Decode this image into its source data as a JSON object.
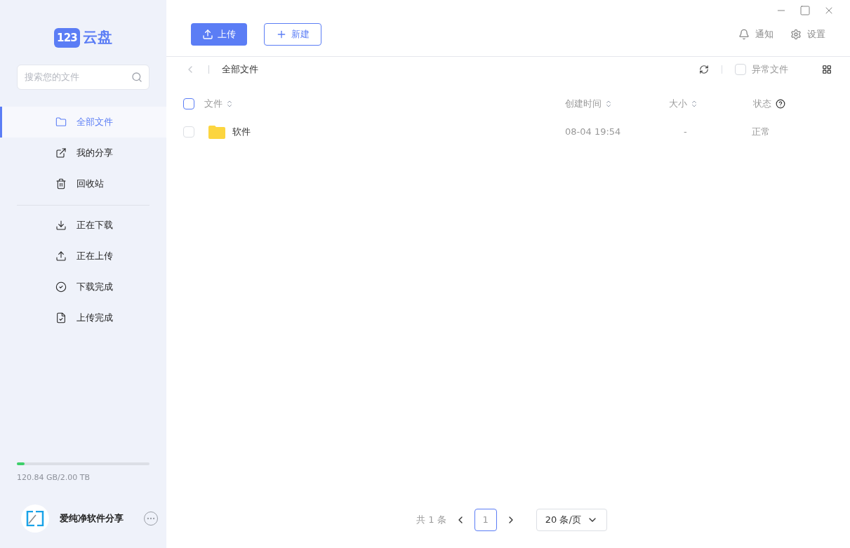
{
  "logo": {
    "badge": "123",
    "name": "云盘"
  },
  "search": {
    "placeholder": "搜索您的文件"
  },
  "nav_groups": [
    [
      {
        "label": "全部文件",
        "selected": true
      },
      {
        "label": "我的分享",
        "selected": false
      },
      {
        "label": "回收站",
        "selected": false
      }
    ],
    [
      {
        "label": "正在下载",
        "selected": false
      },
      {
        "label": "正在上传",
        "selected": false
      },
      {
        "label": "下载完成",
        "selected": false
      },
      {
        "label": "上传完成",
        "selected": false
      }
    ]
  ],
  "storage": {
    "level": 0.06,
    "reading": "120.84 GB/2.00 TB"
  },
  "user": {
    "name": "爱纯净软件分享"
  },
  "toolbar": {
    "upload": "上传",
    "new": "新建",
    "notify": "通知",
    "settings": "设置"
  },
  "breadcrumb": {
    "path": "全部文件",
    "abnormal_filter": {
      "label": "异常文件",
      "checked": false
    }
  },
  "table": {
    "all_checked": false,
    "columns": [
      {
        "label": "文件",
        "sortable": true
      },
      {
        "label": "创建时间",
        "sortable": true
      },
      {
        "label": "大小",
        "sortable": true
      },
      {
        "label": "状态",
        "sortable": false
      }
    ],
    "rows": [
      {
        "name": "软件",
        "kind": "folder",
        "created": "08-04 19:54",
        "size": "-",
        "status": "正常",
        "checked": false
      }
    ]
  },
  "pagination": {
    "total": "共 1 条",
    "pages": [
      {
        "label": "1",
        "selected": true
      }
    ],
    "page_size": "20 条/页"
  }
}
